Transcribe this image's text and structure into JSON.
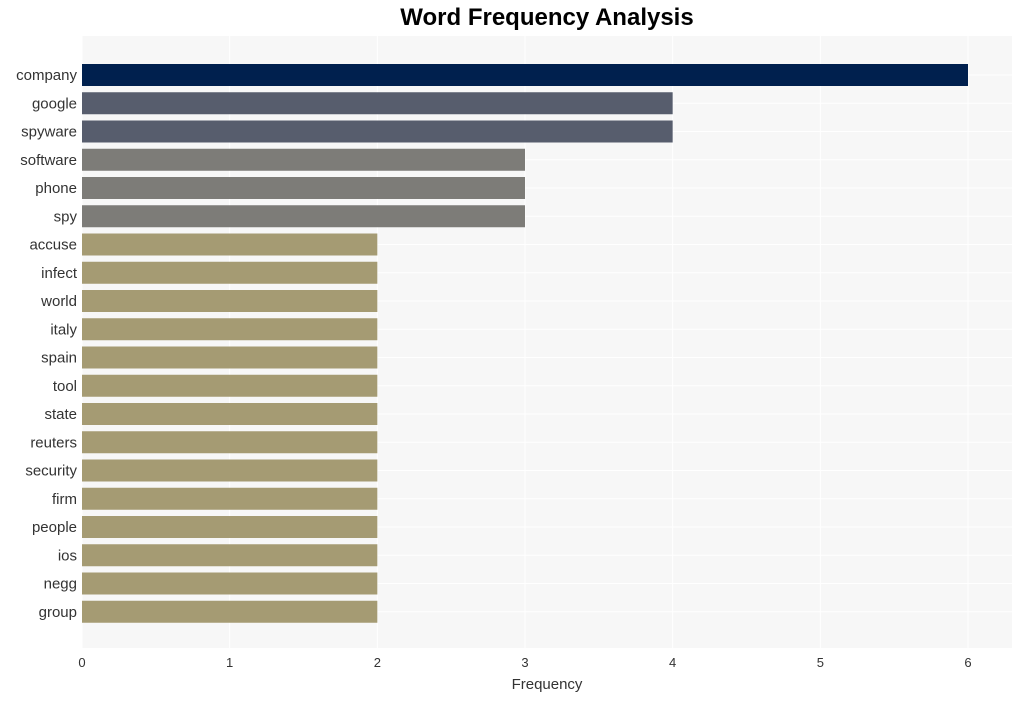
{
  "chart_data": {
    "type": "bar",
    "orientation": "horizontal",
    "title": "Word Frequency Analysis",
    "xlabel": "Frequency",
    "ylabel": "",
    "xlim": [
      0,
      6.3
    ],
    "xticks": [
      0,
      1,
      2,
      3,
      4,
      5,
      6
    ],
    "grid": true,
    "categories": [
      "company",
      "google",
      "spyware",
      "software",
      "phone",
      "spy",
      "accuse",
      "infect",
      "world",
      "italy",
      "spain",
      "tool",
      "state",
      "reuters",
      "security",
      "firm",
      "people",
      "ios",
      "negg",
      "group"
    ],
    "values": [
      6,
      4,
      4,
      3,
      3,
      3,
      2,
      2,
      2,
      2,
      2,
      2,
      2,
      2,
      2,
      2,
      2,
      2,
      2,
      2
    ],
    "colors": {
      "6": "#00204e",
      "4": "#575d6d",
      "3": "#7d7c78",
      "2": "#a59b73"
    },
    "plot_background": "#f7f7f7",
    "grid_color": "#ffffff"
  }
}
